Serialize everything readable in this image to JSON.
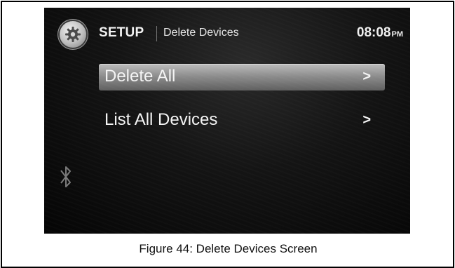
{
  "header": {
    "section": "SETUP",
    "subtitle": "Delete Devices",
    "time": "08:08",
    "ampm": "PM"
  },
  "menu": {
    "items": [
      {
        "label": "Delete All",
        "chevron": ">",
        "selected": true
      },
      {
        "label": "List All Devices",
        "chevron": ">",
        "selected": false
      }
    ]
  },
  "icons": {
    "settings": "gear-icon",
    "bluetooth": "bluetooth-icon"
  },
  "caption": "Figure 44: Delete Devices Screen",
  "colors": {
    "screen_bg": "#0a0a0a",
    "highlight": "#9a9a9a",
    "text": "#f4f4f4"
  }
}
